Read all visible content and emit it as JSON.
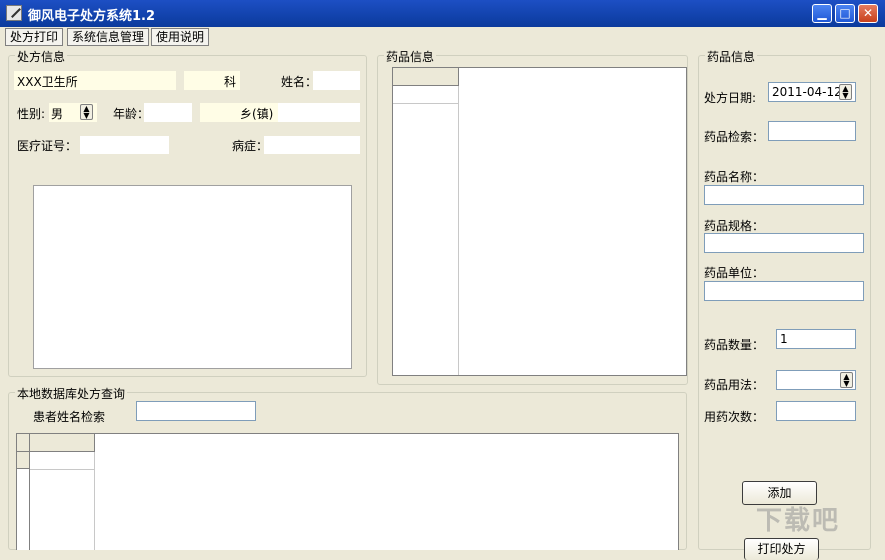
{
  "window": {
    "title": "御风电子处方系统1.2",
    "min": "▁",
    "max": "□",
    "close": "✕"
  },
  "menu": [
    "处方打印",
    "系统信息管理",
    "使用说明"
  ],
  "prescription": {
    "group_title": "处方信息",
    "clinic": "XXX卫生所",
    "dept_suffix": "科",
    "name_label": "姓名：",
    "gender_label": "性别:",
    "gender_value": "男",
    "age_label": "年龄：",
    "town_label": "乡(镇)",
    "card_label": "医疗证号：",
    "disease_label": "病症："
  },
  "drug_list": {
    "group_title": "药品信息"
  },
  "drug_form": {
    "group_title": "药品信息",
    "date_label": "处方日期:",
    "date_value": "2011-04-12",
    "search_label": "药品检索：",
    "name_label": "药品名称：",
    "spec_label": "药品规格：",
    "unit_label": "药品单位：",
    "qty_label": "药品数量：",
    "qty_value": "1",
    "usage_label": "药品用法：",
    "times_label": "用药次数：",
    "add_button": "添加",
    "print_button": "打印处方"
  },
  "query": {
    "group_title": "本地数据库处方查询",
    "search_label": "患者姓名检索"
  },
  "watermark": "下载吧"
}
